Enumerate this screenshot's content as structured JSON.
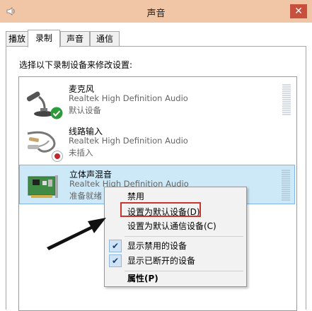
{
  "window": {
    "title": "声音",
    "close_glyph": "✕",
    "title_bar_color": "#f0c6a6"
  },
  "tabs": [
    {
      "label": "播放",
      "active": false
    },
    {
      "label": "录制",
      "active": true
    },
    {
      "label": "声音",
      "active": false
    },
    {
      "label": "通信",
      "active": false
    }
  ],
  "instruction": "选择以下录制设备来修改设置:",
  "devices": [
    {
      "name": "麦克风",
      "driver": "Realtek High Definition Audio",
      "status": "默认设备",
      "icon": "microphone-icon",
      "badge": "default-check-badge",
      "selected": false
    },
    {
      "name": "线路输入",
      "driver": "Realtek High Definition Audio",
      "status": "未插入",
      "icon": "line-in-cable-icon",
      "badge": "unplugged-badge",
      "selected": false
    },
    {
      "name": "立体声混音",
      "driver": "Realtek High Definition Audio",
      "status": "准备就绪",
      "icon": "sound-card-icon",
      "badge": "",
      "selected": true
    }
  ],
  "context_menu": {
    "items": [
      {
        "label": "禁用",
        "checked": false
      },
      {
        "label": "设置为默认设备(D)",
        "checked": false,
        "highlighted": true
      },
      {
        "label": "设置为默认通信设备(C)",
        "checked": false
      },
      {
        "label": "显示禁用的设备",
        "checked": true
      },
      {
        "label": "显示已断开的设备",
        "checked": true
      },
      {
        "label": "属性(P)",
        "checked": false,
        "bold": true
      }
    ],
    "check_glyph": "✔"
  },
  "colors": {
    "selection": "#cde8f7",
    "highlight_box": "#c8342e"
  }
}
